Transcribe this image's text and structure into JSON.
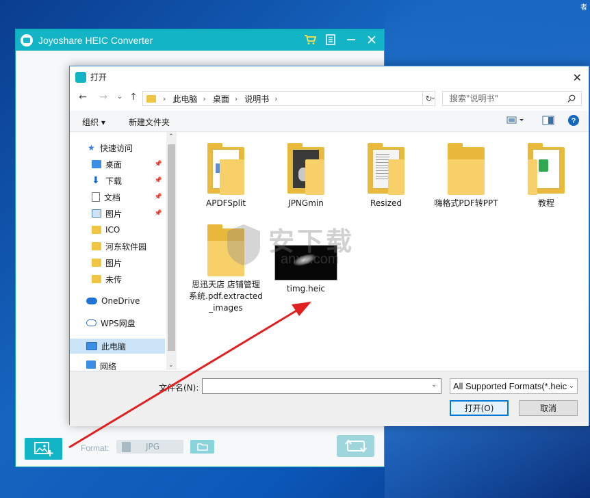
{
  "desktop": {
    "corner_text": "者"
  },
  "app": {
    "title": "Joyoshare HEIC Converter",
    "format_label": "Format:",
    "format_value": "JPG"
  },
  "dialog": {
    "title": "打开",
    "breadcrumb": [
      "此电脑",
      "桌面",
      "说明书"
    ],
    "search_placeholder": "搜索\"说明书\"",
    "toolbar": {
      "organize": "组织",
      "new_folder": "新建文件夹"
    },
    "nav": [
      {
        "label": "快速访问",
        "icon": "star-icon",
        "pinned": false
      },
      {
        "label": "桌面",
        "icon": "desktop-icon",
        "pinned": true
      },
      {
        "label": "下载",
        "icon": "download-icon",
        "pinned": true
      },
      {
        "label": "文档",
        "icon": "document-icon",
        "pinned": true
      },
      {
        "label": "图片",
        "icon": "picture-icon",
        "pinned": true
      },
      {
        "label": "ICO",
        "icon": "folder-icon",
        "pinned": false
      },
      {
        "label": "河东软件园",
        "icon": "folder-icon",
        "pinned": false
      },
      {
        "label": "图片",
        "icon": "folder-icon",
        "pinned": false
      },
      {
        "label": "未传",
        "icon": "folder-icon",
        "pinned": false
      },
      {
        "label": "OneDrive",
        "icon": "cloud-icon",
        "pinned": false
      },
      {
        "label": "WPS网盘",
        "icon": "cloud-icon",
        "pinned": false
      },
      {
        "label": "此电脑",
        "icon": "computer-icon",
        "pinned": false,
        "selected": true
      },
      {
        "label": "网络",
        "icon": "network-icon",
        "pinned": false
      }
    ],
    "files": [
      {
        "name": "APDFSplit",
        "type": "folder"
      },
      {
        "name": "JPNGmin",
        "type": "folder"
      },
      {
        "name": "Resized",
        "type": "folder"
      },
      {
        "name": "嗨格式PDF转PPT",
        "type": "folder"
      },
      {
        "name": "教程",
        "type": "folder"
      },
      {
        "name": "思迅天店 店铺管理系统.pdf.extracted_images",
        "type": "folder"
      },
      {
        "name": "timg.heic",
        "type": "image"
      }
    ],
    "filename_label": "文件名(N):",
    "filename_value": "",
    "filetype_value": "All Supported Formats(*.heic",
    "open_button": "打开(O)",
    "cancel_button": "取消"
  },
  "watermark": {
    "text": "安下载",
    "sub": "anxz.com"
  },
  "colors": {
    "accent": "#12b4c6",
    "arrow": "#e02020",
    "selection": "#cce4f7"
  }
}
